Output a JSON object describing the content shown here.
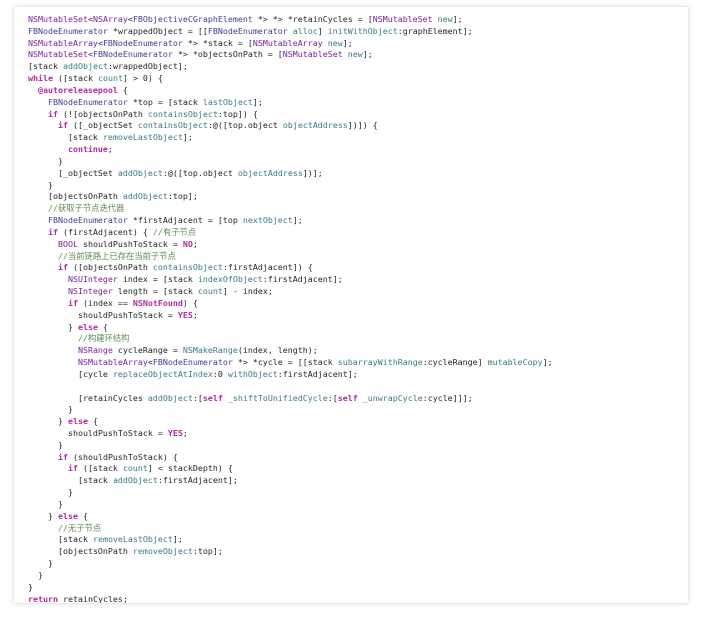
{
  "colors": {
    "background": "#ffffff",
    "plain": "#262626",
    "type": "#7b1fa2",
    "keyword": "#b02aa0",
    "method": "#3a7b86",
    "class": "#3f3f8f",
    "comment": "#5f8a54"
  },
  "code": {
    "language": "objective-c",
    "lines": [
      {
        "indent": 2,
        "text": "NSMutableSet<NSArray<FBObjectiveCGraphElement *> *> *retainCycles = [NSMutableSet new];"
      },
      {
        "indent": 2,
        "text": "FBNodeEnumerator *wrappedObject = [[FBNodeEnumerator alloc] initWithObject:graphElement];"
      },
      {
        "indent": 2,
        "text": "NSMutableArray<FBNodeEnumerator *> *stack = [NSMutableArray new];"
      },
      {
        "indent": 2,
        "text": "NSMutableSet<FBNodeEnumerator *> *objectsOnPath = [NSMutableSet new];"
      },
      {
        "indent": 2,
        "text": "[stack addObject:wrappedObject];"
      },
      {
        "indent": 2,
        "text": "while ([stack count] > 0) {"
      },
      {
        "indent": 4,
        "text": "@autoreleasepool {"
      },
      {
        "indent": 6,
        "text": "FBNodeEnumerator *top = [stack lastObject];"
      },
      {
        "indent": 6,
        "text": "if (![objectsOnPath containsObject:top]) {"
      },
      {
        "indent": 8,
        "text": "if ([_objectSet containsObject:@([top.object objectAddress])]) {"
      },
      {
        "indent": 10,
        "text": "[stack removeLastObject];"
      },
      {
        "indent": 10,
        "text": "continue;"
      },
      {
        "indent": 8,
        "text": "}"
      },
      {
        "indent": 8,
        "text": "[_objectSet addObject:@([top.object objectAddress])];"
      },
      {
        "indent": 6,
        "text": "}"
      },
      {
        "indent": 6,
        "text": "[objectsOnPath addObject:top];"
      },
      {
        "indent": 6,
        "text": "//获取子节点迭代器"
      },
      {
        "indent": 6,
        "text": "FBNodeEnumerator *firstAdjacent = [top nextObject];"
      },
      {
        "indent": 6,
        "text": "if (firstAdjacent) { //有子节点"
      },
      {
        "indent": 8,
        "text": "BOOL shouldPushToStack = NO;"
      },
      {
        "indent": 8,
        "text": "//当前链路上已存在当前子节点"
      },
      {
        "indent": 8,
        "text": "if ([objectsOnPath containsObject:firstAdjacent]) {"
      },
      {
        "indent": 10,
        "text": "NSUInteger index = [stack indexOfObject:firstAdjacent];"
      },
      {
        "indent": 10,
        "text": "NSInteger length = [stack count] - index;"
      },
      {
        "indent": 10,
        "text": "if (index == NSNotFound) {"
      },
      {
        "indent": 12,
        "text": "shouldPushToStack = YES;"
      },
      {
        "indent": 10,
        "text": "} else {"
      },
      {
        "indent": 12,
        "text": "//构建环结构"
      },
      {
        "indent": 12,
        "text": "NSRange cycleRange = NSMakeRange(index, length);"
      },
      {
        "indent": 12,
        "text": "NSMutableArray<FBNodeEnumerator *> *cycle = [[stack subarrayWithRange:cycleRange] mutableCopy];"
      },
      {
        "indent": 12,
        "text": "[cycle replaceObjectAtIndex:0 withObject:firstAdjacent];"
      },
      {
        "indent": 0,
        "text": ""
      },
      {
        "indent": 12,
        "text": "[retainCycles addObject:[self _shiftToUnifiedCycle:[self _unwrapCycle:cycle]]];"
      },
      {
        "indent": 10,
        "text": "}"
      },
      {
        "indent": 8,
        "text": "} else {"
      },
      {
        "indent": 10,
        "text": "shouldPushToStack = YES;"
      },
      {
        "indent": 8,
        "text": "}"
      },
      {
        "indent": 8,
        "text": "if (shouldPushToStack) {"
      },
      {
        "indent": 10,
        "text": "if ([stack count] < stackDepth) {"
      },
      {
        "indent": 12,
        "text": "[stack addObject:firstAdjacent];"
      },
      {
        "indent": 10,
        "text": "}"
      },
      {
        "indent": 8,
        "text": "}"
      },
      {
        "indent": 6,
        "text": "} else {"
      },
      {
        "indent": 8,
        "text": "//无子节点"
      },
      {
        "indent": 8,
        "text": "[stack removeLastObject];"
      },
      {
        "indent": 8,
        "text": "[objectsOnPath removeObject:top];"
      },
      {
        "indent": 6,
        "text": "}"
      },
      {
        "indent": 4,
        "text": "}"
      },
      {
        "indent": 2,
        "text": "}"
      },
      {
        "indent": 2,
        "text": "return retainCycles;"
      },
      {
        "indent": 0,
        "text": "}"
      }
    ]
  }
}
